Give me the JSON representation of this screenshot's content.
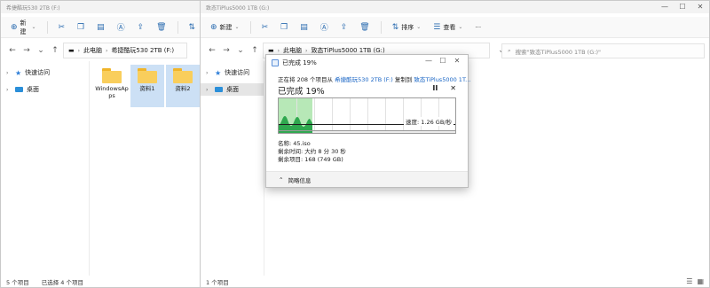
{
  "left_window": {
    "title": "希捷酷玩530 2TB (F:)",
    "toolbar": {
      "new_label": "新建"
    },
    "address": {
      "items": [
        "此电脑",
        "希捷酷玩530 2TB (F:)"
      ]
    },
    "nav": {
      "quick_access": "快速访问",
      "desktop": "桌面"
    },
    "folders": [
      {
        "label": "WindowsApps",
        "selected": false
      },
      {
        "label": "资料1",
        "selected": true
      },
      {
        "label": "资料2",
        "selected": true
      }
    ],
    "status": {
      "count": "5 个项目",
      "selected": "已选择 4 个项目"
    }
  },
  "right_window": {
    "title": "致态TiPlus5000 1TB (G:)",
    "toolbar": {
      "new_label": "新建",
      "sort_label": "排序",
      "view_label": "查看",
      "more_label": "···"
    },
    "address": {
      "items": [
        "此电脑",
        "致态TiPlus5000 1TB (G:)"
      ]
    },
    "search": {
      "placeholder": "搜索\"致态TiPlus5000 1TB (G:)\""
    },
    "nav": {
      "quick_access": "快速访问",
      "desktop": "桌面"
    },
    "status": {
      "count": "1 个项目"
    }
  },
  "dialog": {
    "title": "已完成 19%",
    "line_prefix": "正在将 208 个项目从",
    "source": "希捷酷玩530 2TB (F:)",
    "line_mid": "复制到",
    "destination": "致态TiPlus5000 1T...",
    "percent_label": "已完成 19%",
    "progress": 0.19,
    "speed": "速度: 1.26 GB/秒",
    "name": "名称: 45.iso",
    "time_left": "剩余时间: 大约 8 分 30 秒",
    "items_left": "剩余项目: 168 (749 GB)",
    "less_details": "简略信息"
  },
  "icons": {
    "new": "plus-circle-icon",
    "cut": "scissors-icon",
    "copy": "copy-icon",
    "paste": "paste-icon",
    "rename": "rename-icon",
    "share": "share-icon",
    "delete": "trash-icon",
    "sort": "sort-icon",
    "view": "view-icon",
    "pause": "pause-icon",
    "cancel": "close-icon"
  },
  "colors": {
    "accent": "#1a66c5",
    "progress_fill": "#2fa84f",
    "graph_fill": "#b7e8b7",
    "folder": "#f9ce5c",
    "selection": "#cce0f5"
  }
}
